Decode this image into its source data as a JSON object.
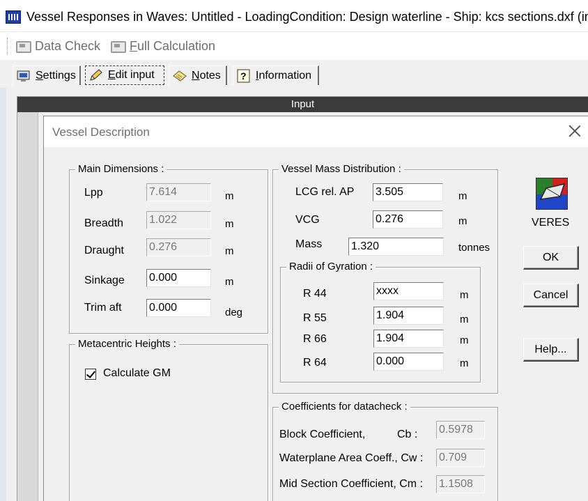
{
  "window": {
    "title": "Vessel Responses in Waves: Untitled - LoadingCondition: Design waterline - Ship: kcs sections.dxf (imp"
  },
  "toolbar": {
    "data_check": "Data Check",
    "full_calc_underlined": "F",
    "full_calc_rest": "ull Calculation"
  },
  "tabs": [
    {
      "u": "S",
      "rest": "ettings"
    },
    {
      "u": "E",
      "rest": "dit input"
    },
    {
      "u": "N",
      "rest": "otes"
    },
    {
      "u": "I",
      "rest": "nformation"
    }
  ],
  "input_header": "Input",
  "dialog": {
    "title": "Vessel Description",
    "main_dimensions": {
      "legend": "Main Dimensions :",
      "rows": [
        {
          "label": "Lpp",
          "value": "7.614",
          "unit": "m"
        },
        {
          "label": "Breadth",
          "value": "1.022",
          "unit": "m"
        },
        {
          "label": "Draught",
          "value": "0.276",
          "unit": "m"
        },
        {
          "label": "Sinkage",
          "value": "0.000",
          "unit": "m"
        },
        {
          "label": "Trim aft",
          "value": "0.000",
          "unit": "deg"
        }
      ]
    },
    "metacentric": {
      "legend": "Metacentric Heights :",
      "calc_gm_label": "Calculate GM",
      "calc_gm_checked": true
    },
    "mass_distribution": {
      "legend": "Vessel Mass Distribution :",
      "lcg": {
        "label": "LCG rel. AP",
        "value": "3.505",
        "unit": "m"
      },
      "vcg": {
        "label": "VCG",
        "value": "0.276",
        "unit": "m"
      },
      "mass": {
        "label": "Mass",
        "value": "1.320",
        "unit": "tonnes"
      },
      "radii": {
        "legend": "Radii of Gyration :",
        "rows": [
          {
            "label": "R 44",
            "value": "xxxx",
            "unit": "m"
          },
          {
            "label": "R 55",
            "value": "1.904",
            "unit": "m"
          },
          {
            "label": "R 66",
            "value": "1.904",
            "unit": "m"
          },
          {
            "label": "R 64",
            "value": "0.000",
            "unit": "m"
          }
        ]
      }
    },
    "coefficients": {
      "legend": "Coefficients for datacheck :",
      "rows": [
        {
          "label": "Block Coefficient,",
          "symbol": "Cb :",
          "value": "0.5978"
        },
        {
          "label": "Waterplane Area Coeff., Cw :",
          "value": "0.709"
        },
        {
          "label": "Mid Section Coefficient, Cm :",
          "value": "1.1508"
        }
      ]
    },
    "veres_label": "VERES",
    "buttons": {
      "ok": "OK",
      "cancel": "Cancel",
      "help": "Help..."
    }
  }
}
